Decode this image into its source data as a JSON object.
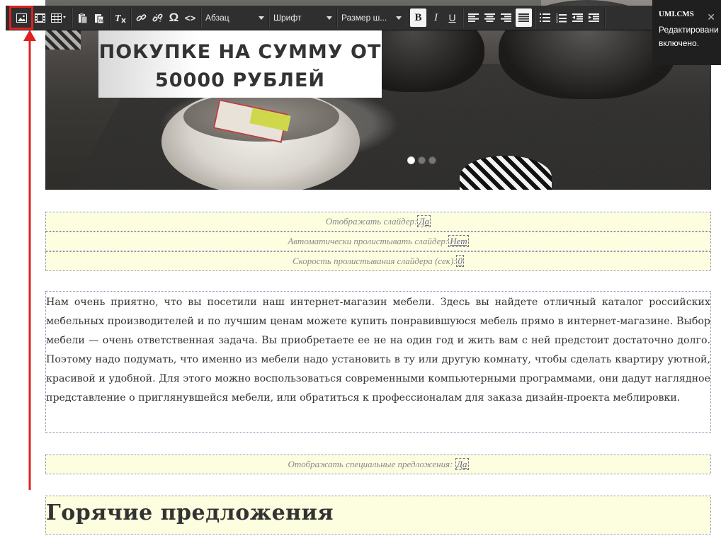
{
  "hero": {
    "promo_line1": "ПОКУПКЕ НА СУММУ ОТ",
    "promo_line2": "50000 РУБЛЕЙ",
    "slides_total": 3,
    "slide_active": 1
  },
  "toolbar": {
    "format_select": "Абзац",
    "font_select": "Шрифт",
    "size_select": "Размер ш...",
    "bold_label": "B",
    "italic_label": "I",
    "underline_label": "U",
    "special_char_label": "Ω",
    "source_label": "<>"
  },
  "notification": {
    "title": "UMI.CMS",
    "message_line1": "Редактировани",
    "message_line2": "включено.",
    "close_label": "✕"
  },
  "fields": [
    {
      "label": "Отображать слайдер:",
      "value": "Да"
    },
    {
      "label": "Автоматически пролистывать слайдер:",
      "value": "Нет"
    },
    {
      "label": "Скорость пролистывания слайдера (сек):",
      "value": "0"
    },
    {
      "label": "Отображать специальные предложения:",
      "value": "Да"
    }
  ],
  "content": {
    "paragraph": "Нам очень приятно, что вы посетили наш интернет-магазин мебели. Здесь вы найдете отличный каталог российских мебельных производителей и по лучшим ценам можете купить понравившуюся мебель прямо в интернет-магазине. Выбор мебели — очень ответственная задача. Вы приобретаете ее не на один год и жить вам с ней предстоит достаточно долго. Поэтому надо подумать, что именно из мебели надо установить в ту или другую комнату, чтобы сделать квартиру уютной, красивой и удобной. Для этого можно воспользоваться современными компьютерными программами, они дадут наглядное представление о приглянувшейся мебели, или обратиться к профессионалам для заказа дизайн-проекта меблировки."
  },
  "section": {
    "heading": "Горячие предложения"
  },
  "colors": {
    "toolbar_bg": "#2f2f2f",
    "highlight": "#e02020",
    "editable_bg": "#fdfde0",
    "notify_bg": "#1f1f1f"
  }
}
